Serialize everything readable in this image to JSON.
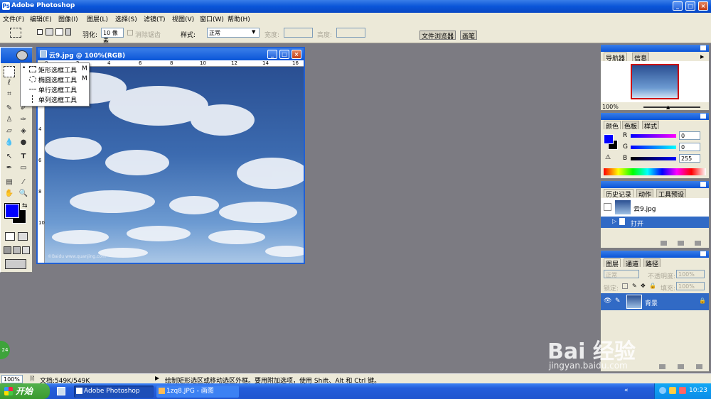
{
  "app": {
    "title": "Adobe Photoshop",
    "window_buttons": [
      "_",
      "□",
      "×"
    ]
  },
  "menu": [
    "文件(F)",
    "编辑(E)",
    "图像(I)",
    "图层(L)",
    "选择(S)",
    "滤镜(T)",
    "视图(V)",
    "窗口(W)",
    "帮助(H)"
  ],
  "options": {
    "feather_label": "羽化:",
    "feather_value": "10 像素",
    "antialias_label": "消除锯齿",
    "style_label": "样式:",
    "style_value": "正常",
    "width_label": "宽度:",
    "height_label": "高度:",
    "tab_browser": "文件浏览器",
    "tab_brush": "画笔"
  },
  "flyout": [
    {
      "label": "矩形选框工具",
      "key": "M"
    },
    {
      "label": "椭圆选框工具",
      "key": "M"
    },
    {
      "label": "单行选框工具",
      "key": ""
    },
    {
      "label": "单列选框工具",
      "key": ""
    }
  ],
  "document": {
    "title": "云9.jpg @ 100%(RGB)",
    "ruler_h": [
      "0",
      "2",
      "4",
      "6",
      "8",
      "10",
      "12",
      "14",
      "16"
    ],
    "ruler_v": [
      "2",
      "4",
      "6",
      "8",
      "10"
    ],
    "watermark": "©Baidu www.quanjing.com"
  },
  "navigator": {
    "tabs": [
      "导航器",
      "信息"
    ],
    "zoom": "100%"
  },
  "color": {
    "tabs": [
      "颜色",
      "色板",
      "样式"
    ],
    "r_label": "R",
    "g_label": "G",
    "b_label": "B",
    "r": "0",
    "g": "0",
    "b": "255",
    "fg_color": "#0000ff",
    "bg_color": "#000000"
  },
  "history": {
    "tabs": [
      "历史记录",
      "动作",
      "工具预设"
    ],
    "items": [
      "云9.jpg",
      "打开"
    ],
    "selected": 1
  },
  "layers": {
    "tabs": [
      "图层",
      "通道",
      "路径"
    ],
    "blend_mode": "正常",
    "opacity_label": "不透明度:",
    "opacity": "100%",
    "lock_label": "锁定:",
    "fill_label": "填充:",
    "fill": "100%",
    "layer_name": "背景"
  },
  "status": {
    "zoom": "100%",
    "doc_size": "文档:549K/549K",
    "hint": "绘制矩形选区或移动选区外框。要用附加选项，使用 Shift、Alt 和 Ctrl 键。"
  },
  "taskbar": {
    "start": "开始",
    "tasks": [
      "Adobe Photoshop",
      "1zq8.JPG - 画图"
    ],
    "clock": "10:23"
  },
  "badge": "24",
  "watermark": {
    "brand": "Bai 经验",
    "url": "jingyan.baidu.com"
  }
}
